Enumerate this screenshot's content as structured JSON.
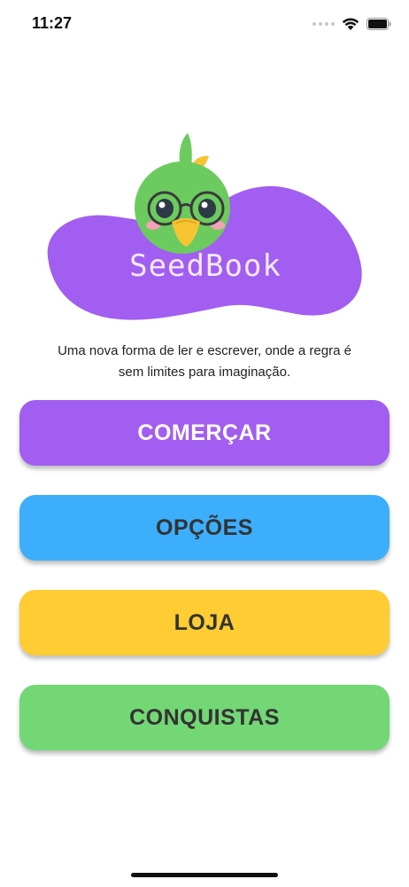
{
  "status_bar": {
    "time": "11:27",
    "icons": [
      "signal-dots-icon",
      "wifi-icon",
      "battery-icon"
    ]
  },
  "logo": {
    "title": "SeedBook",
    "mascot": "green-bird-with-glasses",
    "blob_color": "#a25ef0"
  },
  "tagline": "Uma nova forma de ler e escrever, onde a regra é sem limites para imaginação.",
  "menu": {
    "start_label": "COMERÇAR",
    "options_label": "OPÇÕES",
    "store_label": "LOJA",
    "achievements_label": "CONQUISTAS"
  },
  "colors": {
    "start": "#a25ef0",
    "options": "#3daefc",
    "store": "#ffcc33",
    "achievements": "#73d775"
  }
}
